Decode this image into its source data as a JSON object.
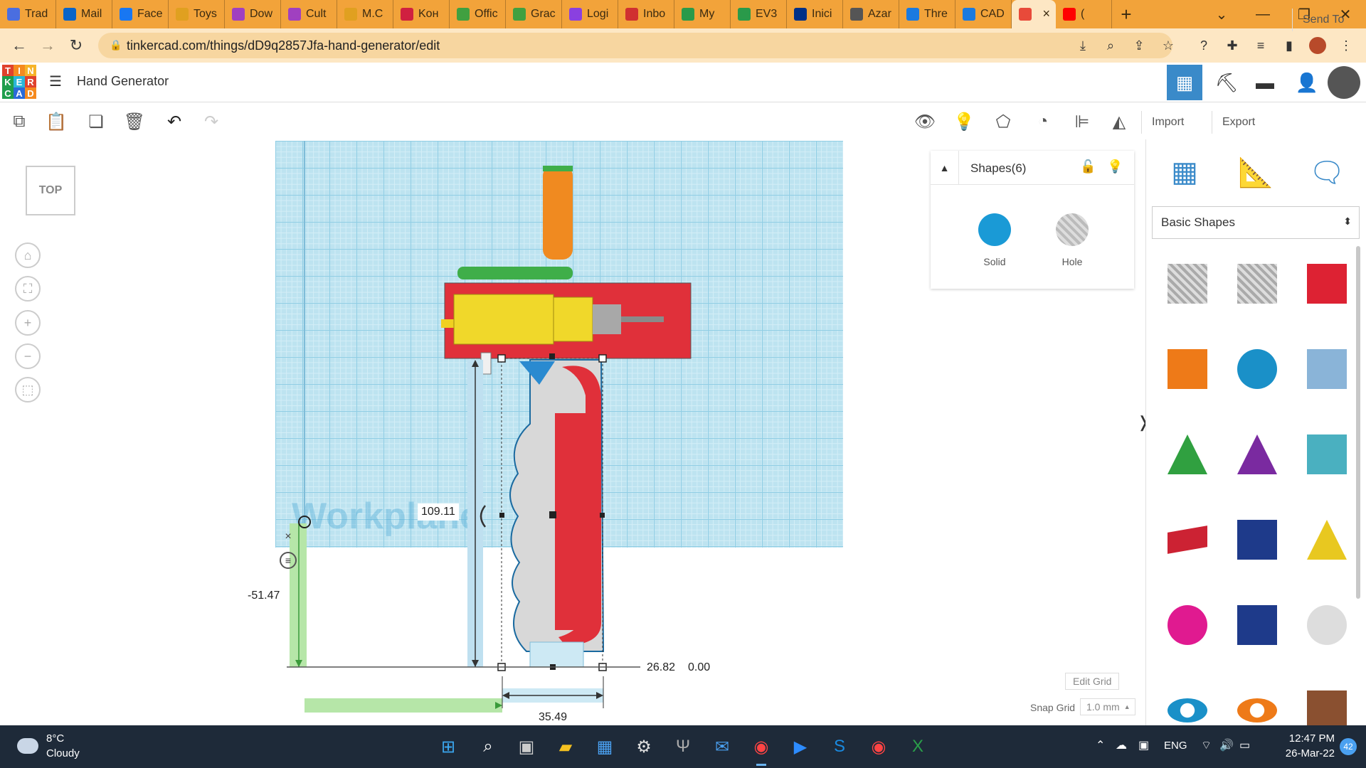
{
  "browser": {
    "tabs": [
      {
        "label": "Trad",
        "icon": "globe-icon",
        "color": "#4a6ee0"
      },
      {
        "label": "Mail",
        "icon": "outlook-icon",
        "color": "#0a64c8"
      },
      {
        "label": "Face",
        "icon": "facebook-icon",
        "color": "#1877f2"
      },
      {
        "label": "Toys",
        "icon": "toy-icon",
        "color": "#e0a020"
      },
      {
        "label": "Dow",
        "icon": "link-icon",
        "color": "#a040c0"
      },
      {
        "label": "Cult",
        "icon": "link-icon",
        "color": "#a040c0"
      },
      {
        "label": "M.C",
        "icon": "toy-icon",
        "color": "#e0a020"
      },
      {
        "label": "Kон",
        "icon": "bookmark-icon",
        "color": "#d02040"
      },
      {
        "label": "Offic",
        "icon": "office-icon",
        "color": "#40a040"
      },
      {
        "label": "Grac",
        "icon": "office-icon",
        "color": "#40a040"
      },
      {
        "label": "Logi",
        "icon": "login-icon",
        "color": "#8a40e0"
      },
      {
        "label": "Inbo",
        "icon": "gmail-icon",
        "color": "#d03030"
      },
      {
        "label": "My",
        "icon": "drive-icon",
        "color": "#2a9a4a"
      },
      {
        "label": "EV3",
        "icon": "drive-icon",
        "color": "#2a9a4a"
      },
      {
        "label": "Inici",
        "icon": "paypal-icon",
        "color": "#003087"
      },
      {
        "label": "Azar",
        "icon": "wikipedia-icon",
        "color": "#555555"
      },
      {
        "label": "Thre",
        "icon": "threads-icon",
        "color": "#1a7ae0"
      },
      {
        "label": "CAD",
        "icon": "cad-icon",
        "color": "#1a7ae0"
      },
      {
        "label": "",
        "icon": "tinkercad-icon",
        "color": "#e84a3a",
        "active": true
      },
      {
        "label": "(",
        "icon": "youtube-icon",
        "color": "#ff0000"
      }
    ],
    "url": "tinkercad.com/things/dD9q2857Jfa-hand-generator/edit"
  },
  "app": {
    "logo_letters": [
      "T",
      "I",
      "N",
      "K",
      "E",
      "R",
      "C",
      "A",
      "D"
    ],
    "logo_colors": [
      "#e0422d",
      "#f58a1f",
      "#f6b42a",
      "#1f9e4d",
      "#2ab6d9",
      "#e0422d",
      "#1f9e4d",
      "#2a6ad9",
      "#f58a1f"
    ],
    "title": "Hand Generator"
  },
  "toolbar": {
    "import_label": "Import",
    "export_label": "Export",
    "sendto_label": "Send To"
  },
  "viewport": {
    "viewcube_label": "TOP",
    "workplane_text": "Workplane",
    "dim_height": "109.11",
    "dim_y": "-51.47",
    "dim_x": "26.82",
    "dim_z": "0.00",
    "dim_width": "35.49",
    "edit_grid_label": "Edit Grid",
    "snap_grid_label": "Snap Grid",
    "snap_grid_value": "1.0 mm"
  },
  "shapes_panel": {
    "title": "Shapes(6)",
    "solid_label": "Solid",
    "hole_label": "Hole",
    "solid_color": "#1a9ad6"
  },
  "library": {
    "category": "Basic Shapes",
    "shapes": [
      "box-hole-icon",
      "cylinder-hole-icon",
      "box-icon",
      "cylinder-icon",
      "sphere-icon",
      "scribble-icon",
      "roof-icon",
      "cone-icon",
      "round-roof-icon",
      "text-icon",
      "wedge-icon",
      "pyramid-icon",
      "half-sphere-icon",
      "polygon-icon",
      "paraboloid-icon",
      "torus-icon",
      "tube-icon",
      "heart-icon"
    ]
  },
  "taskbar": {
    "weather_temp": "8°C",
    "weather_desc": "Cloudy",
    "language": "ENG",
    "time": "12:47 PM",
    "date": "26-Mar-22",
    "notifications": "42"
  }
}
